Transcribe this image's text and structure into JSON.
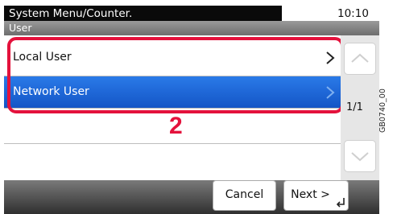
{
  "header": {
    "title": "System Menu/Counter.",
    "time": "10:10",
    "subtitle": "User"
  },
  "list": {
    "items": [
      {
        "label": "Local User",
        "selected": false
      },
      {
        "label": "Network User",
        "selected": true
      }
    ]
  },
  "annotation": {
    "step_number": "2",
    "highlight_color": "#e4123c"
  },
  "pagination": {
    "page": "1/1"
  },
  "footer": {
    "cancel_label": "Cancel",
    "next_label": "Next >"
  },
  "figure_id": "GB0740_00",
  "colors": {
    "selected_row": "#1c63d8",
    "title_bar": "#0a0a0a"
  }
}
